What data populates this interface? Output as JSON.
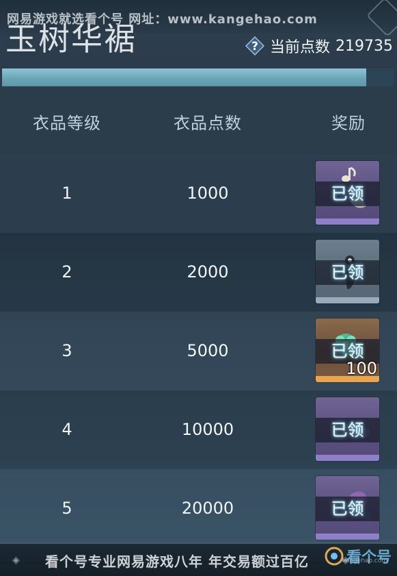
{
  "watermark": {
    "top_text": "网易游戏就选看个号  网址：www.kangehao.com",
    "bottom_text": "看个号专业网易游戏八年  年交易额过百亿",
    "logo_text": "看个号",
    "logo_url": "kangehao.com"
  },
  "header": {
    "title": "玉树华裾",
    "points_label": "当前点数",
    "points_value": "219735",
    "help_icon": "question-diamond-icon"
  },
  "progress": {
    "fraction": 0.93,
    "fill_color": "#8fc3d2"
  },
  "table": {
    "columns": [
      "衣品等级",
      "衣品点数",
      "奖励"
    ],
    "rows": [
      {
        "level": "1",
        "points": "1000",
        "reward_status": "已领",
        "reward_icon": "music-note-icon",
        "reward_quality": "purple",
        "reward_qty": ""
      },
      {
        "level": "2",
        "points": "2000",
        "reward_status": "已领",
        "reward_icon": "ornament-icon",
        "reward_quality": "grey",
        "reward_qty": ""
      },
      {
        "level": "3",
        "points": "5000",
        "reward_status": "已领",
        "reward_icon": "jade-flower-icon",
        "reward_quality": "gold",
        "reward_qty": "100"
      },
      {
        "level": "4",
        "points": "10000",
        "reward_status": "已领",
        "reward_icon": "purple-box-icon",
        "reward_quality": "purple",
        "reward_qty": ""
      },
      {
        "level": "5",
        "points": "20000",
        "reward_status": "已领",
        "reward_icon": "purple-box-icon",
        "reward_quality": "purple",
        "reward_qty": ""
      }
    ]
  },
  "colors": {
    "background": "#2c3d4c",
    "progress_fill": "#8fc3d2",
    "reward_purple": "#5a5181",
    "reward_gold": "#e9a450",
    "claimed_glow": "#7fd8ff"
  }
}
